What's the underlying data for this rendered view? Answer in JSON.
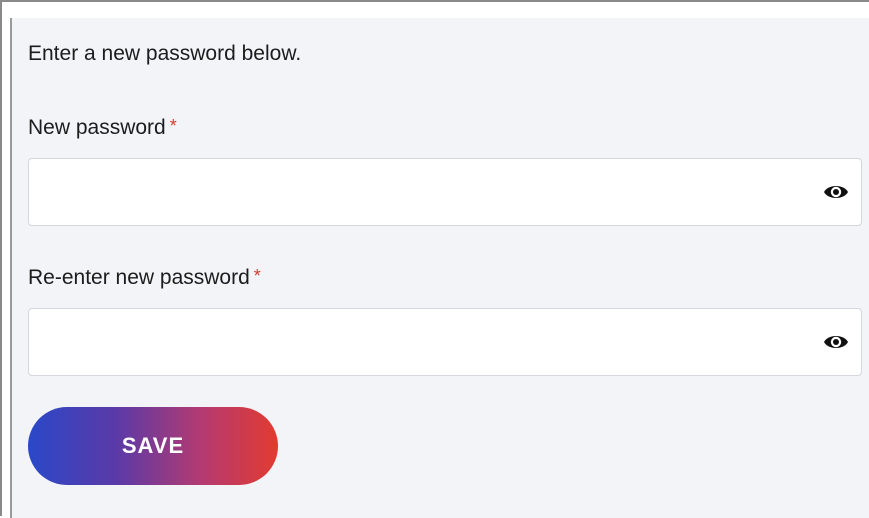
{
  "form": {
    "intro_text": "Enter a new password below.",
    "required_marker": "*",
    "new_password": {
      "label": "New password",
      "value": "",
      "toggle_icon": "eye-icon"
    },
    "confirm_password": {
      "label": "Re-enter new password",
      "value": "",
      "toggle_icon": "eye-icon"
    },
    "save_label": "SAVE"
  },
  "colors": {
    "background": "#f2f4f7",
    "required": "#d63a2f",
    "button_gradient_start": "#2a48c8",
    "button_gradient_end": "#e23b30"
  }
}
